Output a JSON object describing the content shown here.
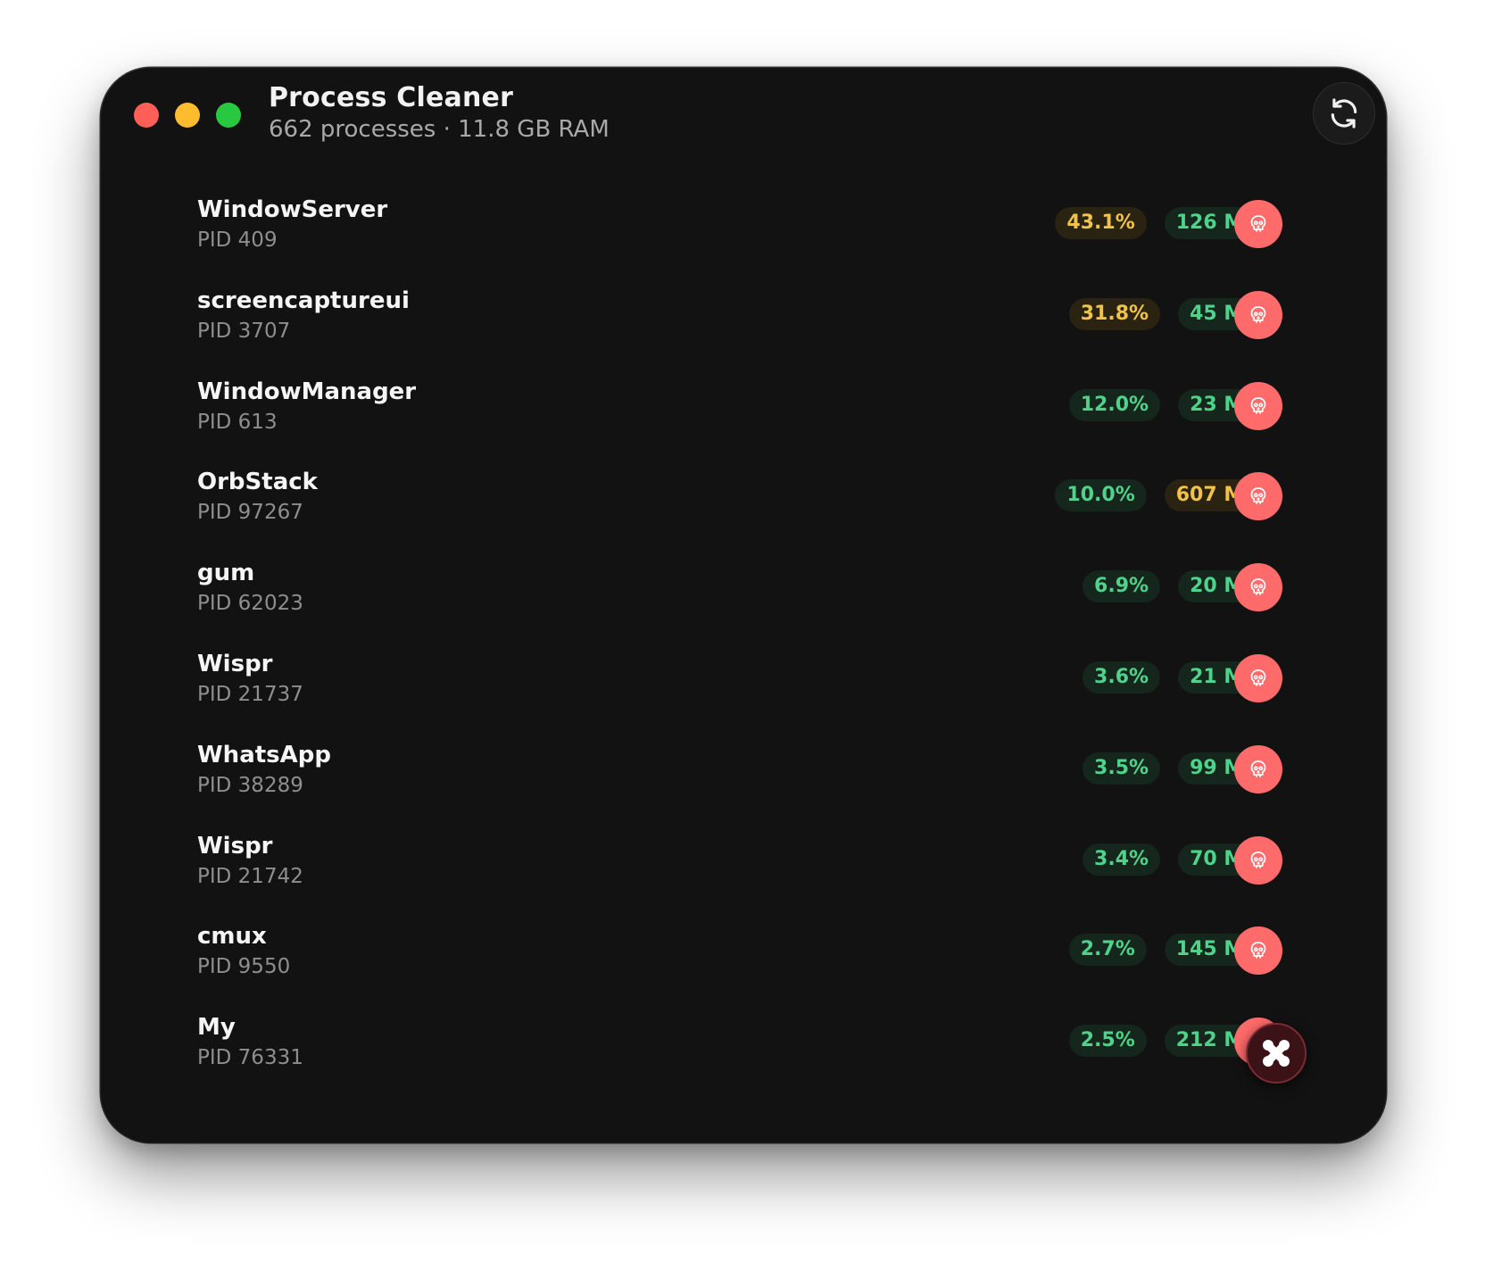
{
  "window": {
    "title": "Process Cleaner",
    "subtitle": "662 processes · 11.8 GB RAM"
  },
  "icons": {
    "refresh": "refresh-icon",
    "kill": "skull-icon",
    "app": "app-shortcut-icon"
  },
  "colors": {
    "background": "#121212",
    "kill_button": "#ff6b6b",
    "pill_green_text": "#4fd38a",
    "pill_amber_text": "#f0c24a"
  },
  "processes": [
    {
      "name": "WindowServer",
      "pid": "PID 409",
      "cpu": "43.1%",
      "cpu_level": "amber",
      "mem": "126 MB",
      "mem_level": "green"
    },
    {
      "name": "screencaptureui",
      "pid": "PID 3707",
      "cpu": "31.8%",
      "cpu_level": "amber",
      "mem": "45 MB",
      "mem_level": "green"
    },
    {
      "name": "WindowManager",
      "pid": "PID 613",
      "cpu": "12.0%",
      "cpu_level": "green",
      "mem": "23 MB",
      "mem_level": "green"
    },
    {
      "name": "OrbStack",
      "pid": "PID 97267",
      "cpu": "10.0%",
      "cpu_level": "green",
      "mem": "607 MB",
      "mem_level": "amber"
    },
    {
      "name": "gum",
      "pid": "PID 62023",
      "cpu": "6.9%",
      "cpu_level": "green",
      "mem": "20 MB",
      "mem_level": "green"
    },
    {
      "name": "Wispr",
      "pid": "PID 21737",
      "cpu": "3.6%",
      "cpu_level": "green",
      "mem": "21 MB",
      "mem_level": "green"
    },
    {
      "name": "WhatsApp",
      "pid": "PID 38289",
      "cpu": "3.5%",
      "cpu_level": "green",
      "mem": "99 MB",
      "mem_level": "green"
    },
    {
      "name": "Wispr",
      "pid": "PID 21742",
      "cpu": "3.4%",
      "cpu_level": "green",
      "mem": "70 MB",
      "mem_level": "green"
    },
    {
      "name": "cmux",
      "pid": "PID 9550",
      "cpu": "2.7%",
      "cpu_level": "green",
      "mem": "145 MB",
      "mem_level": "green"
    },
    {
      "name": "My",
      "pid": "PID 76331",
      "cpu": "2.5%",
      "cpu_level": "green",
      "mem": "212 MB",
      "mem_level": "green"
    }
  ]
}
